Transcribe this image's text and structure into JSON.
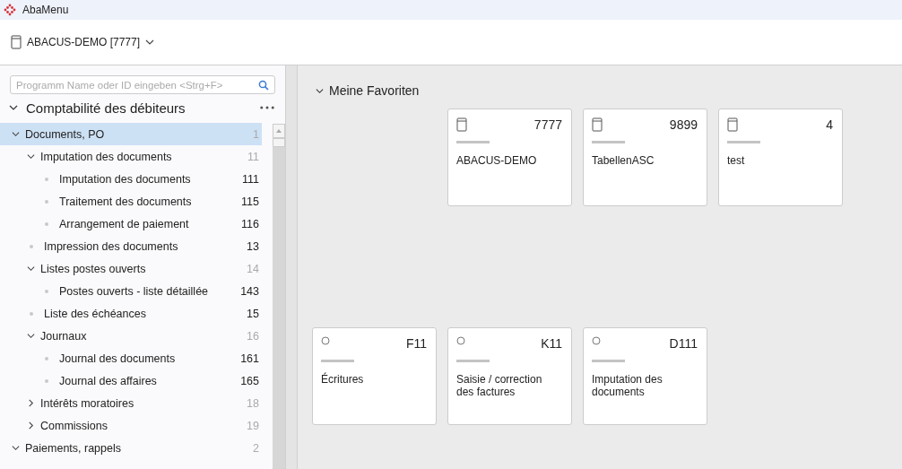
{
  "window": {
    "title": "AbaMenu"
  },
  "header": {
    "company": "ABACUS-DEMO [7777]"
  },
  "search": {
    "placeholder": "Programm Name oder ID eingeben <Strg+F>"
  },
  "module": {
    "title": "Comptabilité des débiteurs",
    "expanded": true
  },
  "tree": [
    {
      "kind": "folder",
      "label": "Documents, PO",
      "number": "1",
      "expanded": true,
      "selected": true,
      "children": [
        {
          "kind": "folder",
          "label": "Imputation des documents",
          "number": "11",
          "expanded": true,
          "selected": false,
          "children": [
            {
              "kind": "program",
              "label": "Imputation des documents",
              "number": "111",
              "selected": false
            },
            {
              "kind": "program",
              "label": "Traitement des documents",
              "number": "115",
              "selected": false
            },
            {
              "kind": "program",
              "label": "Arrangement de paiement",
              "number": "116",
              "selected": false
            }
          ]
        },
        {
          "kind": "program",
          "label": "Impression des documents",
          "number": "13",
          "selected": false
        },
        {
          "kind": "folder",
          "label": "Listes postes ouverts",
          "number": "14",
          "expanded": true,
          "selected": false,
          "children": [
            {
              "kind": "program",
              "label": "Postes ouverts - liste détaillée",
              "number": "143",
              "selected": false
            }
          ]
        },
        {
          "kind": "program",
          "label": "Liste des échéances",
          "number": "15",
          "selected": false
        },
        {
          "kind": "folder",
          "label": "Journaux",
          "number": "16",
          "expanded": true,
          "selected": false,
          "children": [
            {
              "kind": "program",
              "label": "Journal des documents",
              "number": "161",
              "selected": false
            },
            {
              "kind": "program",
              "label": "Journal des affaires",
              "number": "165",
              "selected": false
            }
          ]
        },
        {
          "kind": "folder",
          "label": "Intérêts moratoires",
          "number": "18",
          "expanded": false,
          "selected": false
        },
        {
          "kind": "folder",
          "label": "Commissions",
          "number": "19",
          "expanded": false,
          "selected": false
        }
      ]
    },
    {
      "kind": "folder",
      "label": "Paiements, rappels",
      "number": "2",
      "expanded": true,
      "selected": false
    }
  ],
  "favorites": {
    "title": "Meine Favoriten",
    "expanded": true,
    "rows": [
      [
        "",
        {
          "kind": "database",
          "id": "7777",
          "name": "ABACUS-DEMO"
        },
        {
          "kind": "database",
          "id": "9899",
          "name": "TabellenASC"
        },
        {
          "kind": "database",
          "id": "4",
          "name": "test"
        }
      ],
      [
        {
          "kind": "program",
          "id": "F11",
          "name": "Écritures"
        },
        {
          "kind": "program",
          "id": "K11",
          "name": "Saisie / correction des factures"
        },
        {
          "kind": "program",
          "id": "D111",
          "name": "Imputation des documents"
        }
      ]
    ]
  }
}
